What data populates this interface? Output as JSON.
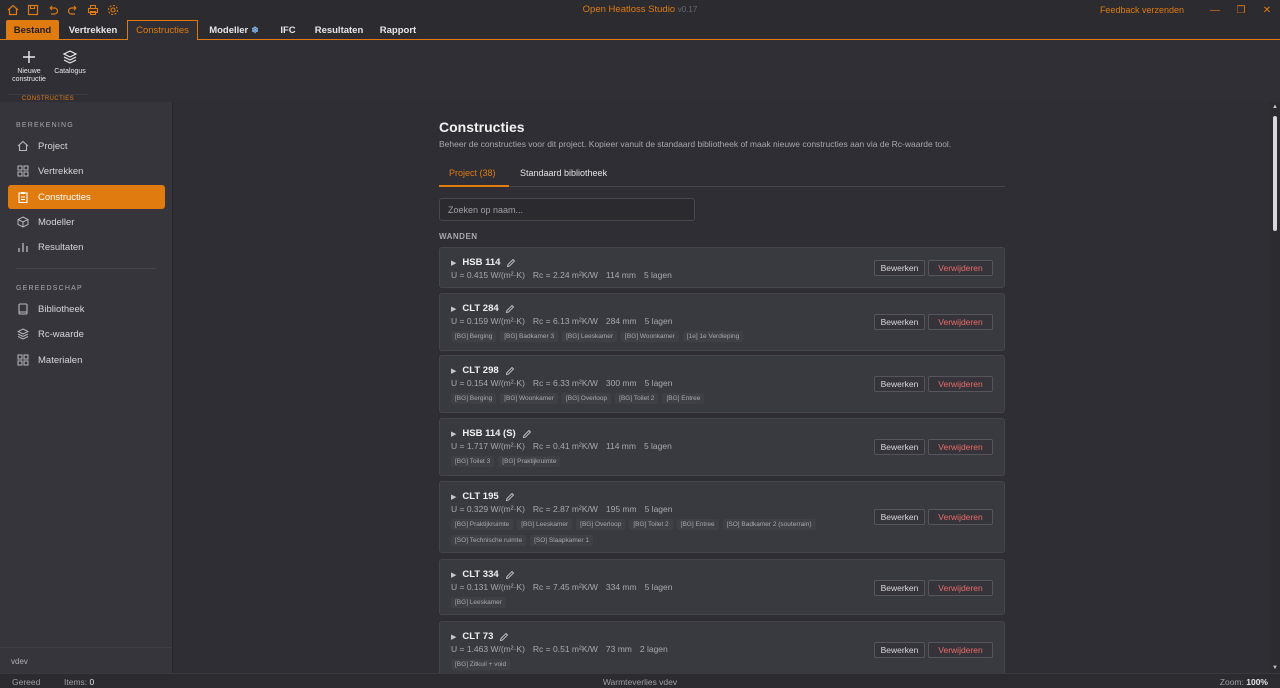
{
  "app": {
    "title": "Open Heatloss Studio",
    "version": "v0.17",
    "feedback": "Feedback verzenden",
    "accent": "#e07b10"
  },
  "menu": {
    "tabs": [
      {
        "label": "Bestand"
      },
      {
        "label": "Vertrekken"
      },
      {
        "label": "Constructies"
      },
      {
        "label": "Modeller"
      },
      {
        "label": "IFC"
      },
      {
        "label": "Resultaten"
      },
      {
        "label": "Rapport"
      }
    ],
    "modeller_badge_icon": "snowflake-icon"
  },
  "ribbon": {
    "new_label_1": "Nieuwe",
    "new_label_2": "constructie",
    "catalog_label": "Catalogus",
    "group_label": "CONSTRUCTIES"
  },
  "sidebar": {
    "section1": "BEREKENING",
    "section2": "GEREEDSCHAP",
    "items": [
      {
        "label": "Project",
        "icon": "home-icon"
      },
      {
        "label": "Vertrekken",
        "icon": "grid-icon"
      },
      {
        "label": "Constructies",
        "icon": "clipboard-icon"
      },
      {
        "label": "Modeller",
        "icon": "cube-icon"
      },
      {
        "label": "Resultaten",
        "icon": "bar-chart-icon"
      },
      {
        "label": "Bibliotheek",
        "icon": "book-icon"
      },
      {
        "label": "Rc-waarde",
        "icon": "layers-icon"
      },
      {
        "label": "Materialen",
        "icon": "grid-icon"
      }
    ],
    "footer": "vdev"
  },
  "main": {
    "title": "Constructies",
    "subtitle": "Beheer de constructies voor dit project. Kopieer vanuit de standaard bibliotheek of maak nieuwe constructies aan via de Rc-waarde tool.",
    "tabs": [
      {
        "label": "Project (38)"
      },
      {
        "label": "Standaard bibliotheek"
      }
    ],
    "search_placeholder": "Zoeken op naam...",
    "section_label": "WANDEN",
    "edit_label": "Bewerken",
    "delete_label": "Verwijderen",
    "constructions": [
      {
        "name": "HSB 114",
        "u": "U = 0.415 W/(m²·K)",
        "rc": "Rc = 2.24 m²K/W",
        "thickness": "114 mm",
        "layers": "5 lagen",
        "rooms": []
      },
      {
        "name": "CLT 284",
        "u": "U = 0.159 W/(m²·K)",
        "rc": "Rc = 6.13 m²K/W",
        "thickness": "284 mm",
        "layers": "5 lagen",
        "rooms": [
          "[BG] Berging",
          "[BG] Badkamer 3",
          "[BG] Leeskamer",
          "[BG] Woonkamer",
          "[1e] 1e Verdieping"
        ]
      },
      {
        "name": "CLT 298",
        "u": "U = 0.154 W/(m²·K)",
        "rc": "Rc = 6.33 m²K/W",
        "thickness": "300 mm",
        "layers": "5 lagen",
        "rooms": [
          "[BG] Berging",
          "[BG] Woonkamer",
          "[BG] Overloop",
          "[BG] Toilet 2",
          "[BG] Entree"
        ]
      },
      {
        "name": "HSB 114 (S)",
        "u": "U = 1.717 W/(m²·K)",
        "rc": "Rc = 0.41 m²K/W",
        "thickness": "114 mm",
        "layers": "5 lagen",
        "rooms": [
          "[BG] Toilet 3",
          "[BG] Praktijkruimte"
        ]
      },
      {
        "name": "CLT 195",
        "u": "U = 0.329 W/(m²·K)",
        "rc": "Rc = 2.87 m²K/W",
        "thickness": "195 mm",
        "layers": "5 lagen",
        "rooms": [
          "[BG] Praktijkruimte",
          "[BG] Leeskamer",
          "[BG] Overloop",
          "[BG] Toilet 2",
          "[BG] Entree",
          "[SO] Badkamer 2 (souterrain)",
          "[SO] Technische ruimte",
          "[SO] Slaapkamer 1"
        ]
      },
      {
        "name": "CLT 334",
        "u": "U = 0.131 W/(m²·K)",
        "rc": "Rc = 7.45 m²K/W",
        "thickness": "334 mm",
        "layers": "5 lagen",
        "rooms": [
          "[BG] Leeskamer"
        ]
      },
      {
        "name": "CLT 73",
        "u": "U = 1.463 W/(m²·K)",
        "rc": "Rc = 0.51 m²K/W",
        "thickness": "73 mm",
        "layers": "2 lagen",
        "rooms": [
          "[BG] Zitkuil + void"
        ]
      }
    ]
  },
  "status": {
    "state": "Gereed",
    "items_label": "Items:",
    "items_count": "0",
    "center": "Warmteverlies vdev",
    "zoom_label": "Zoom:",
    "zoom_value": "100%"
  }
}
